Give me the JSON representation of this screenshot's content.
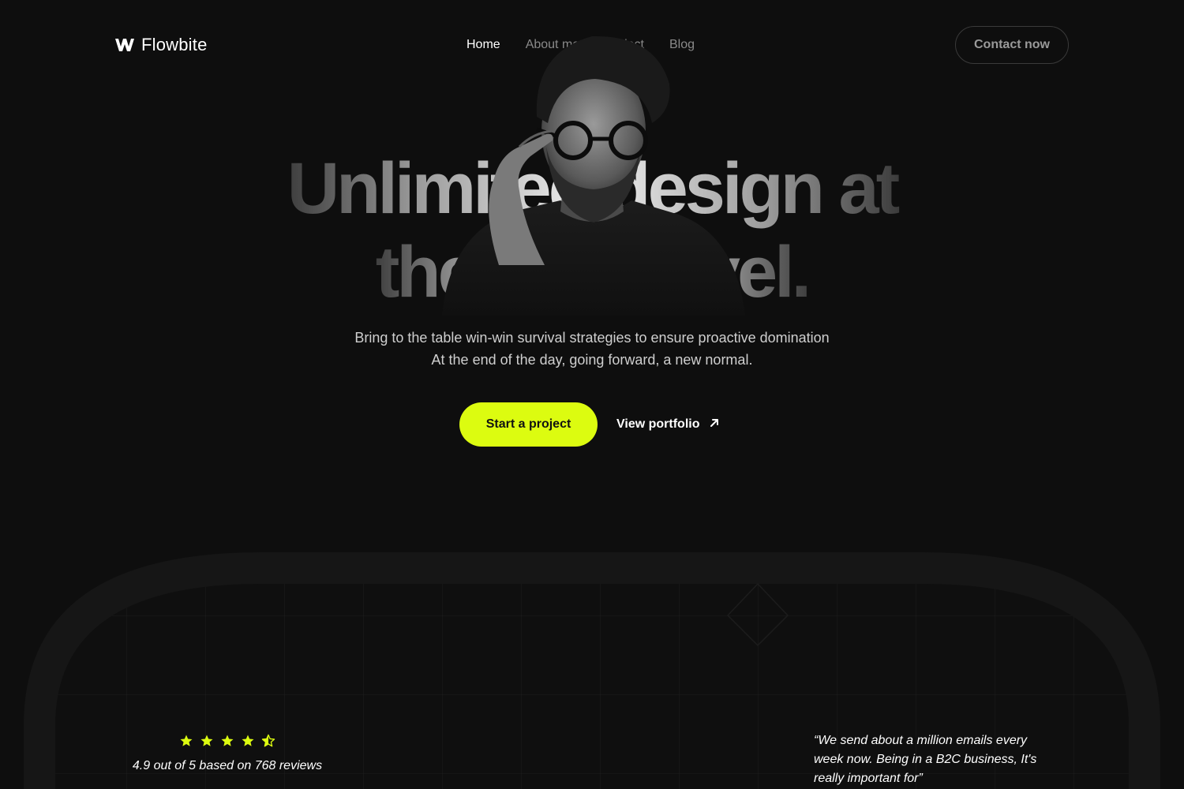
{
  "brand": {
    "name": "Flowbite",
    "logo_icon": "flowbite-logo-icon"
  },
  "nav": {
    "links": [
      {
        "label": "Home",
        "active": true
      },
      {
        "label": "About me",
        "active": false
      },
      {
        "label": "Project",
        "active": false
      },
      {
        "label": "Blog",
        "active": false
      }
    ],
    "contact_label": "Contact now"
  },
  "hero": {
    "title_line1": "Unlimited design at",
    "title_line2": "the next level.",
    "subtitle_line1": "Bring to the table win-win survival strategies to ensure proactive domination",
    "subtitle_line2": "At the end of the day, going forward, a new normal.",
    "primary_cta": "Start a project",
    "secondary_cta": "View portfolio",
    "secondary_cta_icon": "arrow-up-right-icon"
  },
  "rating": {
    "stars": 4.5,
    "max_stars": 5,
    "text": "4.9 out of 5 based on 768 reviews"
  },
  "testimonial": {
    "text": "“We send about a million emails every week now. Being in a B2C business, It's really important for”"
  },
  "colors": {
    "background": "#0e0e0e",
    "accent": "#dcfc10",
    "nav_inactive": "#8a8a8a"
  }
}
